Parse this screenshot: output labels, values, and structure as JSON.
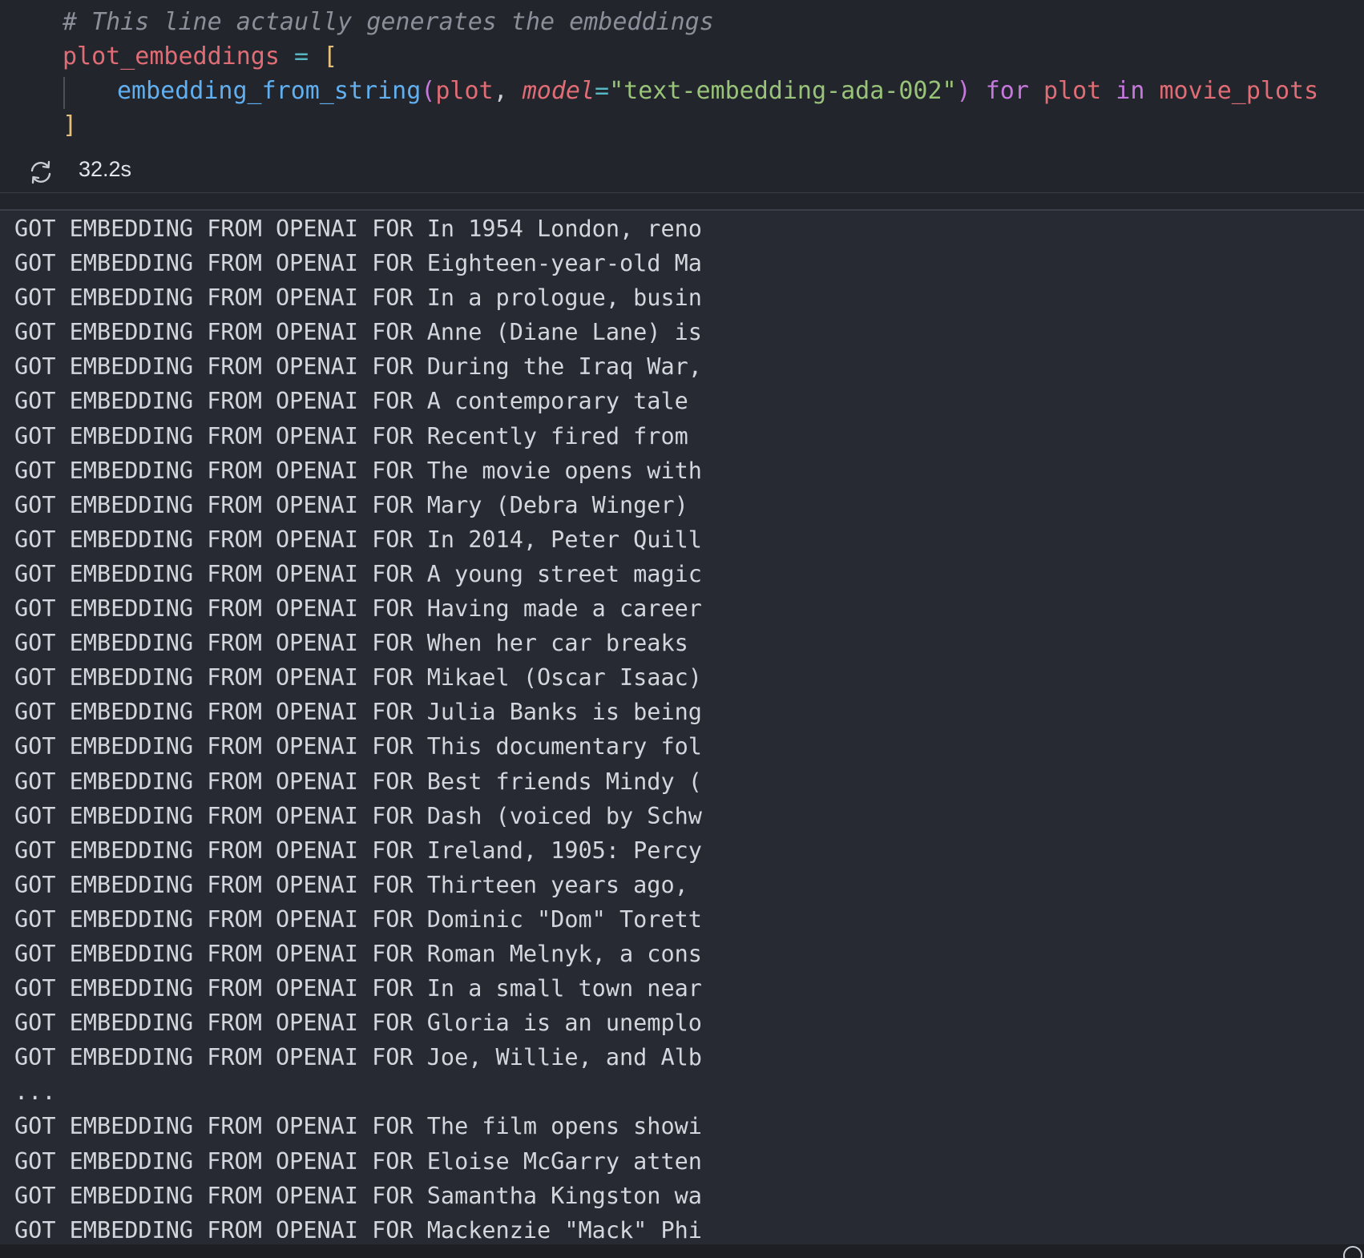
{
  "code": {
    "comment": "# This line actaully generates the embeddings",
    "assign_var": "plot_embeddings",
    "assign_op": " = ",
    "open_bracket": "[",
    "call_fn": "embedding_from_string",
    "paren_open": "(",
    "arg_plot": "plot",
    "comma": ", ",
    "kwarg_name": "model",
    "equals": "=",
    "kwarg_value": "\"text-embedding-ada-002\"",
    "paren_close": ")",
    "kw_for": " for ",
    "loop_var": "plot",
    "kw_in": " in ",
    "iterable": "movie_plots",
    "close_bracket": "]"
  },
  "execution": {
    "elapsed": "32.2s",
    "icon": "refresh-icon"
  },
  "output_lines": [
    "GOT EMBEDDING FROM OPENAI FOR In 1954 London, reno",
    "GOT EMBEDDING FROM OPENAI FOR Eighteen-year-old Ma",
    "GOT EMBEDDING FROM OPENAI FOR In a prologue, busin",
    "GOT EMBEDDING FROM OPENAI FOR Anne (Diane Lane) is",
    "GOT EMBEDDING FROM OPENAI FOR During the Iraq War,",
    "GOT EMBEDDING FROM OPENAI FOR A contemporary tale",
    "GOT EMBEDDING FROM OPENAI FOR Recently fired from",
    "GOT EMBEDDING FROM OPENAI FOR The movie opens with",
    "GOT EMBEDDING FROM OPENAI FOR Mary (Debra Winger)",
    "GOT EMBEDDING FROM OPENAI FOR In 2014, Peter Quill",
    "GOT EMBEDDING FROM OPENAI FOR A young street magic",
    "GOT EMBEDDING FROM OPENAI FOR Having made a career",
    "GOT EMBEDDING FROM OPENAI FOR When her car breaks",
    "GOT EMBEDDING FROM OPENAI FOR Mikael (Oscar Isaac)",
    "GOT EMBEDDING FROM OPENAI FOR Julia Banks is being",
    "GOT EMBEDDING FROM OPENAI FOR This documentary fol",
    "GOT EMBEDDING FROM OPENAI FOR Best friends Mindy (",
    "GOT EMBEDDING FROM OPENAI FOR Dash (voiced by Schw",
    "GOT EMBEDDING FROM OPENAI FOR Ireland, 1905: Percy",
    "GOT EMBEDDING FROM OPENAI FOR Thirteen years ago,",
    "GOT EMBEDDING FROM OPENAI FOR Dominic \"Dom\" Torett",
    "GOT EMBEDDING FROM OPENAI FOR Roman Melnyk, a cons",
    "GOT EMBEDDING FROM OPENAI FOR In a small town near",
    "GOT EMBEDDING FROM OPENAI FOR Gloria is an unemplo",
    "GOT EMBEDDING FROM OPENAI FOR Joe, Willie, and Alb",
    "...",
    "GOT EMBEDDING FROM OPENAI FOR The film opens showi",
    "GOT EMBEDDING FROM OPENAI FOR Eloise McGarry atten",
    "GOT EMBEDDING FROM OPENAI FOR Samantha Kingston wa",
    "GOT EMBEDDING FROM OPENAI FOR Mackenzie \"Mack\" Phi"
  ]
}
